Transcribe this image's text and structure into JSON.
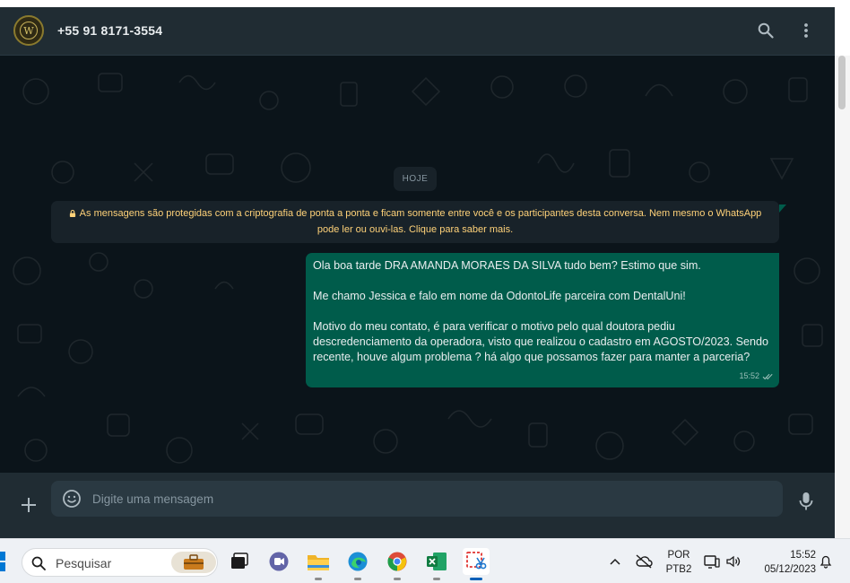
{
  "header": {
    "contact_name": "+55 91 8171-3554",
    "avatar_letter": "W"
  },
  "chat": {
    "date_label": "HOJE",
    "encryption_notice": "As mensagens são protegidas com a criptografia de ponta a ponta e ficam somente entre você e os participantes desta conversa. Nem mesmo o WhatsApp pode ler ou ouvi-las. Clique para saber mais.",
    "message": {
      "line1": "Ola boa tarde DRA AMANDA MORAES DA SILVA tudo bem? Estimo que sim.",
      "line2": "Me chamo Jessica e falo em nome da OdontoLife parceira com DentalUni!",
      "line3": "Motivo do meu contato, é para verificar o motivo pelo qual doutora pediu descredenciamento da operadora, visto que realizou o cadastro em AGOSTO/2023. Sendo recente, houve algum problema ? há algo que possamos fazer para manter a parceria?",
      "time": "15:52"
    }
  },
  "composer": {
    "placeholder": "Digite uma mensagem"
  },
  "taskbar": {
    "search_placeholder": "Pesquisar",
    "lang_line1": "POR",
    "lang_line2": "PTB2",
    "time": "15:52",
    "date": "05/12/2023"
  },
  "colors": {
    "app_bg": "#0b141a",
    "header_bg": "#202c33",
    "outgoing_bubble": "#005c4b",
    "notice_text": "#ffd279"
  }
}
